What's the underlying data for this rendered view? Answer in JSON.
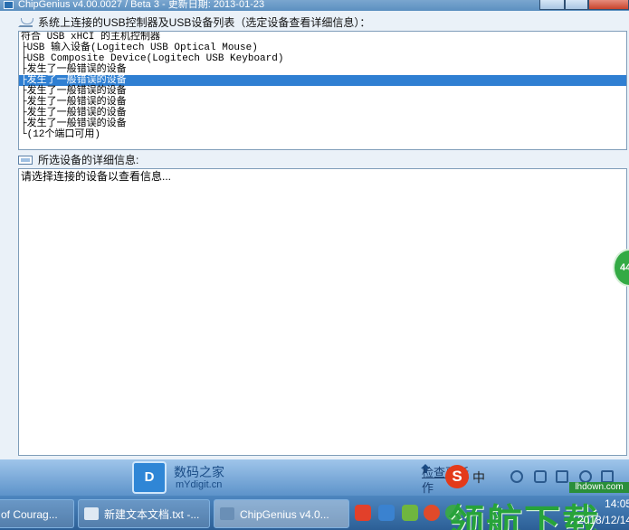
{
  "window": {
    "title": "ChipGenius v4.00.0027 / Beta 3 - 更新日期: 2013-01-23"
  },
  "device_list": {
    "header": "系统上连接的USB控制器及USB设备列表（选定设备查看详细信息）：",
    "selected_index": 4,
    "rows": [
      "符合 USB xHCI 的主机控制器",
      "├USB 输入设备(Logitech USB Optical Mouse)",
      "├USB Composite Device(Logitech USB Keyboard)",
      "├发生了一般错误的设备",
      "├发生了一般错误的设备",
      "├发生了一般错误的设备",
      "├发生了一般错误的设备",
      "├发生了一般错误的设备",
      "├发生了一般错误的设备",
      "└(12个端口可用)"
    ]
  },
  "details": {
    "header": "所选设备的详细信息:",
    "text": "请选择连接的设备以查看信息..."
  },
  "footer": {
    "site_name": "数码之家",
    "site_url": "mYdigit.cn",
    "check_update": "检查更新",
    "author": "作"
  },
  "float_badge": "44",
  "ime": {
    "logo": "S",
    "lang": "中"
  },
  "watermark": {
    "text": "领航下载",
    "url": "lhdown.com"
  },
  "taskbar": {
    "items": [
      {
        "label": "of Courag...",
        "active": false
      },
      {
        "label": "新建文本文档.txt -...",
        "active": false
      },
      {
        "label": "ChipGenius v4.0...",
        "active": true
      }
    ],
    "clock_time": "14:05",
    "clock_date": "2018/12/14"
  },
  "colors": {
    "selection": "#2f7fd2",
    "titlebar": "#5b8fc0",
    "watermark": "#27a33a"
  }
}
